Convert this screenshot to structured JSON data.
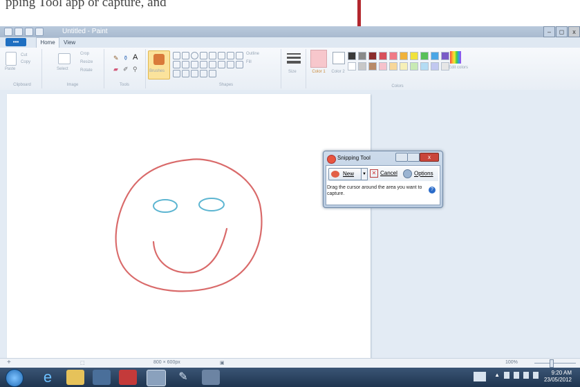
{
  "caption": "pping Tool app                                              or capture, and",
  "app": {
    "title": "Untitled - Paint",
    "window_controls": [
      "–",
      "◻",
      "x"
    ]
  },
  "ribbon": {
    "menu": "▪▪▪",
    "tabs": [
      "Home",
      "View"
    ],
    "clipboard": {
      "label": "Clipboard",
      "paste": "Paste",
      "cut": "Cut",
      "copy": "Copy"
    },
    "image": {
      "label": "Image",
      "select": "Select",
      "crop": "Crop",
      "resize": "Resize",
      "rotate": "Rotate"
    },
    "tools": {
      "label": "Tools",
      "text_glyph": "A"
    },
    "brushes": "Brushes",
    "shapes": {
      "label": "Shapes",
      "outline": "Outline",
      "fill": "Fill"
    },
    "size": "Size",
    "color1": "Color 1",
    "color2": "Color 2",
    "colors_label": "Colors",
    "edit_colors": "Edit colors"
  },
  "palette": [
    "#3a3a3a",
    "#8a8a8a",
    "#8a2c2c",
    "#d8505c",
    "#f07a86",
    "#f0b23c",
    "#f0e23c",
    "#59c05a",
    "#4aa6e6",
    "#7a5cc7",
    "#ffffff",
    "#c8c8c8",
    "#b88a68",
    "#f6c2cc",
    "#f7d79a",
    "#f6f0b8",
    "#c8eab4",
    "#b4dcf4",
    "#c2c8f0",
    "#e6e6e6"
  ],
  "snipping_tool": {
    "title": "Snipping Tool",
    "new_label": "New",
    "cancel_label": "Cancel",
    "options_label": "Options",
    "help_text": "Drag the cursor around the area you want to capture."
  },
  "status": {
    "canvas_size": "800 × 600px",
    "zoom": "100%"
  },
  "taskbar": {
    "time": "9:20 AM",
    "date": "23/05/2012"
  }
}
